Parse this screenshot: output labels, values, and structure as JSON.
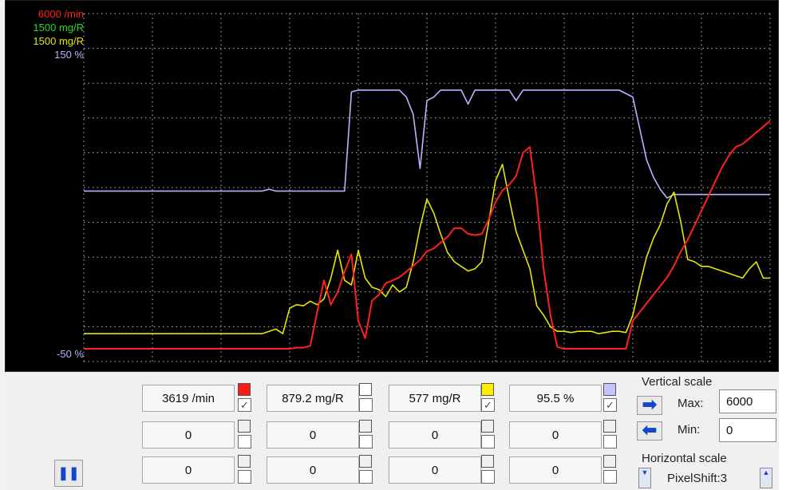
{
  "scope": {
    "axis_labels": [
      {
        "text": "6000 /min",
        "color": "#ff2020"
      },
      {
        "text": "1500 mg/R",
        "color": "#22dd22"
      },
      {
        "text": "1500 mg/R",
        "color": "#e6e600"
      },
      {
        "text": "150 %",
        "color": "#b4b4ff"
      }
    ],
    "bottom_label": {
      "text": "-50 %",
      "color": "#b4b4ff"
    },
    "trace_colors": {
      "rpm": "#ff2020",
      "green": "#22dd22",
      "yellow": "#e6e600",
      "percent": "#b4b4ff"
    }
  },
  "chart_data": {
    "type": "line",
    "xlim": [
      0,
      100
    ],
    "series": [
      {
        "id": "percent",
        "color": "#b4b4ff",
        "ylim": [
          -50,
          150
        ],
        "x": [
          0,
          26,
          27,
          28,
          38,
          39,
          40,
          41,
          42,
          43,
          44,
          45,
          46,
          47,
          48,
          49,
          50,
          51,
          52,
          53,
          55,
          56,
          57,
          58,
          59,
          60,
          61,
          62,
          63,
          64,
          66,
          67,
          68,
          70,
          71,
          72,
          73,
          74,
          75,
          76,
          77,
          78,
          80,
          82,
          83,
          84,
          85,
          86,
          87,
          88,
          89,
          90,
          91,
          92,
          93,
          94,
          95,
          96,
          97,
          98,
          99,
          100
        ],
        "y": [
          48,
          48,
          49,
          48,
          48,
          105,
          106,
          106,
          106,
          106,
          106,
          106,
          106,
          102,
          92,
          61,
          100,
          102,
          106,
          106,
          106,
          98,
          106,
          106,
          106,
          106,
          106,
          106,
          100,
          106,
          106,
          106,
          106,
          106,
          106,
          106,
          106,
          106,
          106,
          106,
          106,
          106,
          102,
          66,
          56,
          49,
          44,
          46,
          46,
          46,
          46,
          46,
          46,
          46,
          46,
          46,
          46,
          46,
          46,
          46,
          46,
          46
        ]
      },
      {
        "id": "yellow",
        "color": "#e6e600",
        "ylim": [
          0,
          1500
        ],
        "x": [
          0,
          26,
          28,
          29,
          30,
          31,
          32,
          33,
          34,
          35,
          36,
          37,
          38,
          39,
          40,
          41,
          42,
          43,
          44,
          45,
          46,
          47,
          48,
          49,
          50,
          51,
          52,
          53,
          54,
          55,
          56,
          57,
          58,
          59,
          60,
          61,
          62,
          63,
          64,
          65,
          66,
          67,
          68,
          69,
          70,
          71,
          72,
          73,
          74,
          75,
          76,
          77,
          78,
          79,
          80,
          81,
          82,
          83,
          84,
          85,
          86,
          87,
          88,
          89,
          90,
          91,
          92,
          93,
          94,
          95,
          96,
          97,
          98,
          99,
          100
        ],
        "y": [
          120,
          120,
          140,
          120,
          230,
          245,
          240,
          260,
          245,
          270,
          360,
          480,
          350,
          330,
          480,
          360,
          320,
          310,
          280,
          330,
          300,
          320,
          430,
          580,
          700,
          640,
          550,
          470,
          430,
          410,
          390,
          400,
          430,
          600,
          780,
          850,
          700,
          560,
          480,
          400,
          240,
          200,
          150,
          130,
          130,
          125,
          130,
          130,
          130,
          120,
          125,
          130,
          130,
          125,
          200,
          330,
          450,
          530,
          590,
          680,
          730,
          600,
          440,
          430,
          410,
          410,
          400,
          390,
          380,
          370,
          360,
          400,
          430,
          360,
          360
        ]
      },
      {
        "id": "rpm",
        "color": "#ff2020",
        "ylim": [
          0,
          6000
        ],
        "x": [
          0,
          28,
          30,
          31,
          32,
          33,
          34,
          35,
          36,
          37,
          38,
          39,
          40,
          41,
          42,
          43,
          44,
          45,
          46,
          47,
          48,
          49,
          50,
          51,
          52,
          53,
          54,
          55,
          56,
          57,
          58,
          59,
          60,
          61,
          62,
          63,
          64,
          65,
          66,
          67,
          68,
          69,
          70,
          72,
          74,
          76,
          78,
          79,
          80,
          81,
          82,
          83,
          84,
          85,
          86,
          87,
          88,
          89,
          90,
          91,
          92,
          93,
          94,
          95,
          96,
          97,
          98,
          99,
          100
        ],
        "y": [
          220,
          220,
          220,
          240,
          240,
          270,
          850,
          1400,
          980,
          1200,
          1550,
          1850,
          700,
          400,
          1050,
          1150,
          1350,
          1400,
          1450,
          1550,
          1650,
          1750,
          1900,
          1950,
          2050,
          2150,
          2300,
          2300,
          2200,
          2180,
          2200,
          2450,
          2750,
          2950,
          3050,
          3200,
          3600,
          3700,
          2800,
          1600,
          800,
          250,
          220,
          220,
          220,
          220,
          220,
          220,
          700,
          850,
          1000,
          1150,
          1300,
          1450,
          1650,
          1900,
          2100,
          2350,
          2600,
          2850,
          3100,
          3350,
          3550,
          3700,
          3750,
          3850,
          3950,
          4050,
          4150
        ]
      }
    ]
  },
  "readouts": {
    "row1": [
      "3619 /min",
      "879.2 mg/R",
      "577 mg/R",
      "95.5 %"
    ],
    "row2": [
      "0",
      "0",
      "0",
      "0"
    ],
    "row3": [
      "0",
      "0",
      "0",
      "0"
    ],
    "checkmark": "✓",
    "swatch_colors": [
      "#ff1a1a",
      "#ffffff",
      "#ffee00",
      "#c4c4ff"
    ]
  },
  "vertical_scale": {
    "title": "Vertical scale",
    "max_label": "Max:",
    "max_value": "6000",
    "min_label": "Min:",
    "min_value": "0"
  },
  "horizontal_scale": {
    "title": "Horizontal scale",
    "value": "PixelShift:3"
  },
  "icons": {
    "increase": "➡",
    "decrease": "⬅",
    "pause": "❚❚",
    "spin_up": "▲",
    "spin_down": "▼"
  }
}
